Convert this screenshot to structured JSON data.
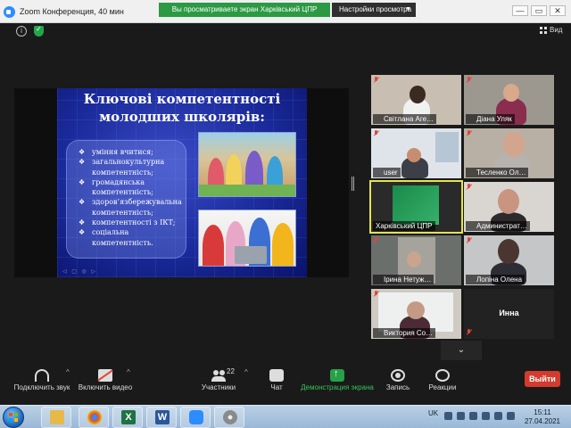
{
  "window": {
    "title": "Zoom Конференция, 40 мин",
    "share_banner": "Вы просматриваете экран Харківський ЦПР",
    "view_options": "Настройки просмотра",
    "buttons": {
      "minimize": "—",
      "restore": "▭",
      "close": "✕"
    }
  },
  "meeting_header": {
    "view_label": "Вид"
  },
  "slide": {
    "title_line1": "Ключові компетентності",
    "title_line2": "молодших школярів:",
    "items": [
      "уміння вчитися;",
      "загальнокультурна компетентність;",
      "громадянська компетентність;",
      "здоров’язбережувальна компетентність;",
      "компетентності з ІКТ;",
      "соціальна компетентність."
    ],
    "bullet": "❖"
  },
  "participants": [
    {
      "name": "Світлана Аге…",
      "muted": true
    },
    {
      "name": "Діана Уляк",
      "muted": true
    },
    {
      "name": "user",
      "muted": true
    },
    {
      "name": "Тесленко Ол…",
      "muted": true
    },
    {
      "name": "Харківський ЦПР",
      "muted": false,
      "active": true
    },
    {
      "name": "Администрат…",
      "muted": true
    },
    {
      "name": "Ірина Нетуж…",
      "muted": true
    },
    {
      "name": "Лопіна Олена",
      "muted": true
    },
    {
      "name": "Виктория Со…",
      "muted": true
    },
    {
      "name": "Инна",
      "muted": true,
      "video_off": true
    }
  ],
  "toolbar": {
    "audio": "Подключить звук",
    "video": "Включить видео",
    "participants": "Участники",
    "participants_count": "22",
    "chat": "Чат",
    "share": "Демонстрация экрана",
    "record": "Запись",
    "reactions": "Реакции",
    "end": "Выйти"
  },
  "taskbar": {
    "apps": [
      {
        "name": "file-explorer",
        "glyph": "",
        "color": "#e7b84a"
      },
      {
        "name": "chrome",
        "glyph": "",
        "color": "#db4437"
      },
      {
        "name": "excel",
        "glyph": "X",
        "color": "#1f7244"
      },
      {
        "name": "word",
        "glyph": "W",
        "color": "#2b579a"
      },
      {
        "name": "zoom",
        "glyph": "",
        "color": "#2d8cff"
      },
      {
        "name": "media-app",
        "glyph": "",
        "color": "#8a8a8a"
      }
    ],
    "language": "UK",
    "time": "15:11",
    "date": "27.04.2021"
  },
  "colors": {
    "share_green": "#2b9a43",
    "end_red": "#d23b2e",
    "active_border": "#e6e34d",
    "slide_blue": "#1a2a9a"
  }
}
